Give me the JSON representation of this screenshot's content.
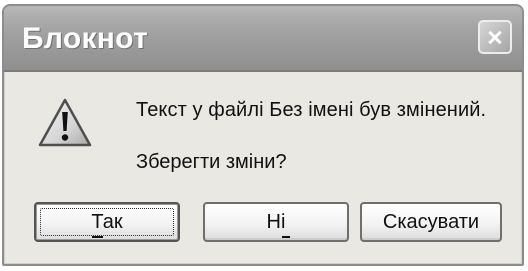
{
  "window": {
    "title": "Блокнот"
  },
  "message": {
    "text": "Текст у файлі Без імені був змінений.",
    "question": "Зберегти зміни?"
  },
  "buttons": {
    "yes": "Так",
    "no": "Ні",
    "cancel": "Скасувати"
  },
  "icons": {
    "warning": "warning-icon",
    "close": "close-icon"
  }
}
